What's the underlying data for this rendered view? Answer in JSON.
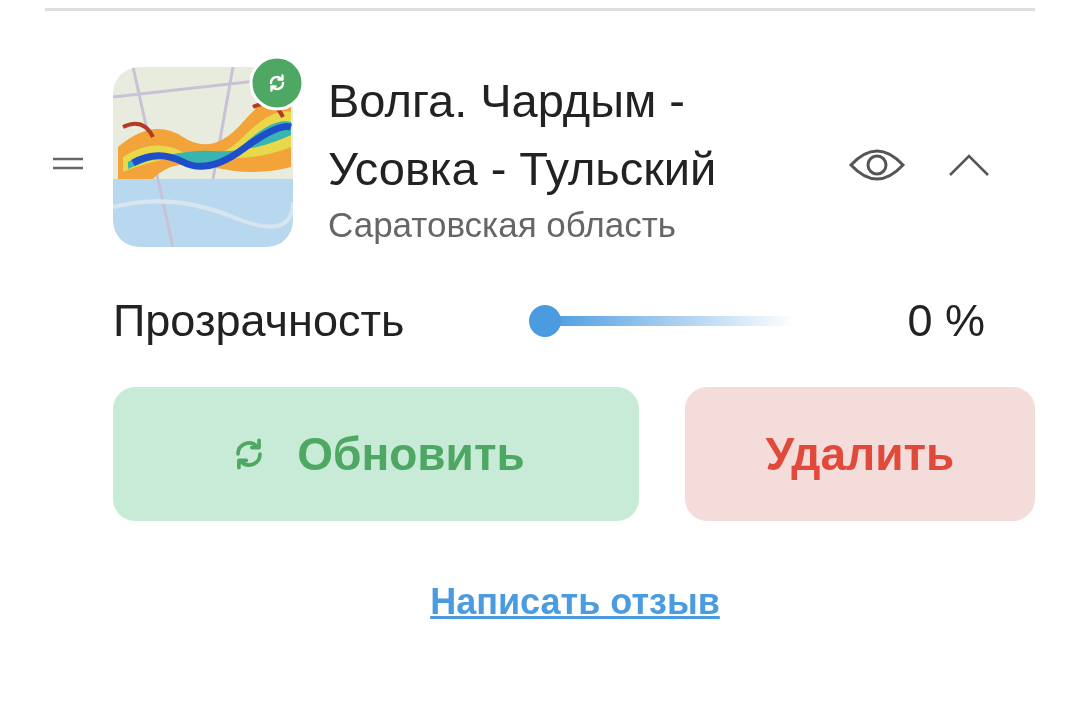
{
  "layer": {
    "title": "Волга. Чардым - Усовка - Тульский",
    "region": "Саратовская область",
    "visible": true,
    "expanded": true
  },
  "opacity": {
    "label": "Прозрачность",
    "level": 0,
    "reading": "0 %"
  },
  "buttons": [
    {
      "label": "Обновить",
      "kind": "update"
    },
    {
      "label": "Удалить",
      "kind": "delete"
    }
  ],
  "feedback_link": "Написать отзыв"
}
